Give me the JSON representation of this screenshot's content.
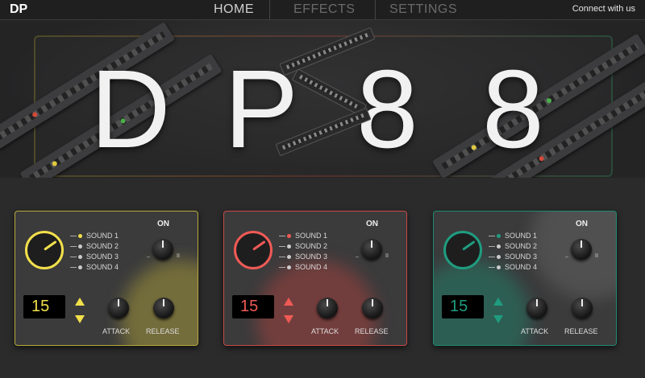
{
  "nav": {
    "logo": "DP",
    "tabs": [
      {
        "label": "HOME",
        "active": true
      },
      {
        "label": "EFFECTS",
        "active": false
      },
      {
        "label": "SETTINGS",
        "active": false
      }
    ],
    "connect": "Connect with us"
  },
  "hero": {
    "letters": [
      "D",
      "P",
      "8",
      "8"
    ]
  },
  "cards": [
    {
      "accent": "#f2e04a",
      "on_label": "ON",
      "sounds": [
        "SOUND 1",
        "SOUND 2",
        "SOUND 3",
        "SOUND 4"
      ],
      "active_sound": 0,
      "value": "15",
      "attack_label": "ATTACK",
      "release_label": "RELEASE",
      "tick_low": "_",
      "tick_high": "II"
    },
    {
      "accent": "#f05a55",
      "on_label": "ON",
      "sounds": [
        "SOUND 1",
        "SOUND 2",
        "SOUND 3",
        "SOUND 4"
      ],
      "active_sound": 0,
      "value": "15",
      "attack_label": "ATTACK",
      "release_label": "RELEASE",
      "tick_low": "_",
      "tick_high": "II"
    },
    {
      "accent": "#1f9c7f",
      "on_label": "ON",
      "sounds": [
        "SOUND 1",
        "SOUND 2",
        "SOUND 3",
        "SOUND 4"
      ],
      "active_sound": 0,
      "value": "15",
      "attack_label": "ATTACK",
      "release_label": "RELEASE",
      "tick_low": "_",
      "tick_high": "II"
    }
  ]
}
